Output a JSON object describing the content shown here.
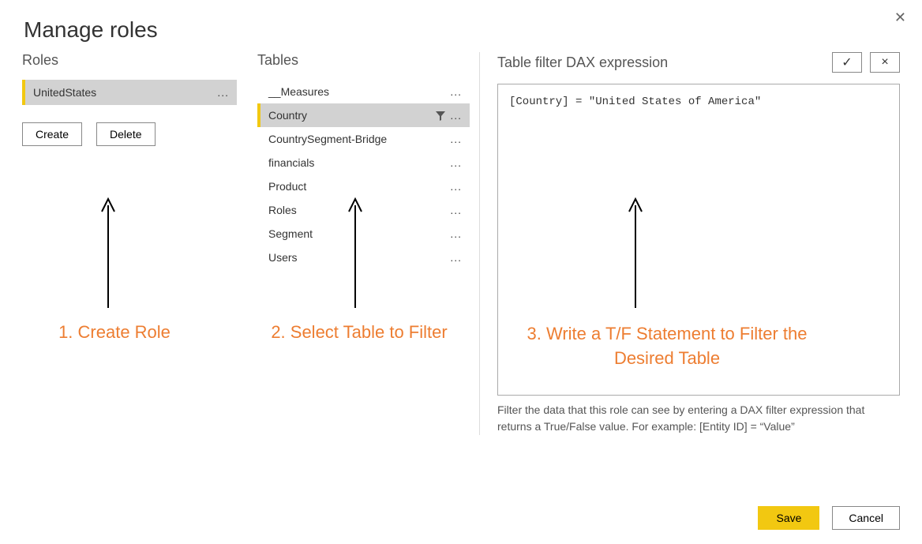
{
  "dialog": {
    "title": "Manage roles"
  },
  "roles": {
    "label": "Roles",
    "selected": "UnitedStates",
    "create_label": "Create",
    "delete_label": "Delete"
  },
  "tables": {
    "label": "Tables",
    "items": [
      {
        "name": "__Measures",
        "selected": false,
        "filtered": false
      },
      {
        "name": "Country",
        "selected": true,
        "filtered": true
      },
      {
        "name": "CountrySegment-Bridge",
        "selected": false,
        "filtered": false
      },
      {
        "name": "financials",
        "selected": false,
        "filtered": false
      },
      {
        "name": "Product",
        "selected": false,
        "filtered": false
      },
      {
        "name": "Roles",
        "selected": false,
        "filtered": false
      },
      {
        "name": "Segment",
        "selected": false,
        "filtered": false
      },
      {
        "name": "Users",
        "selected": false,
        "filtered": false
      }
    ]
  },
  "dax": {
    "label": "Table filter DAX expression",
    "expression": "[Country] = \"United States of America\"",
    "hint": "Filter the data that this role can see by entering a DAX filter expression that returns a True/False value. For example: [Entity ID] = “Value”",
    "accept_glyph": "✓",
    "reject_glyph": "×"
  },
  "footer": {
    "save_label": "Save",
    "cancel_label": "Cancel"
  },
  "annotations": {
    "step1": "1. Create Role",
    "step2": "2. Select Table to Filter",
    "step3": "3. Write a T/F Statement to Filter the Desired Table"
  }
}
